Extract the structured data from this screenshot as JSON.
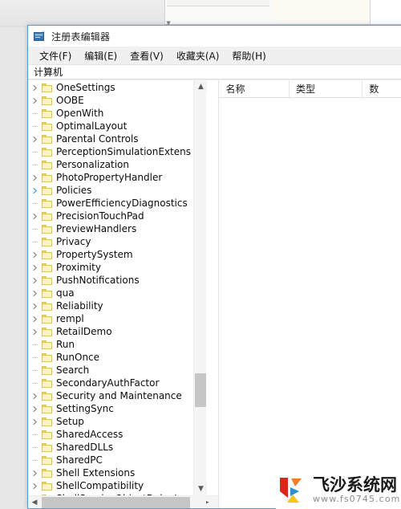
{
  "background": {
    "chevron_icon": "chevron-down-icon"
  },
  "window": {
    "title": "注册表编辑器",
    "app_icon": "registry-editor-icon",
    "menus": [
      {
        "label": "文件(F)",
        "name": "menu-file"
      },
      {
        "label": "编辑(E)",
        "name": "menu-edit"
      },
      {
        "label": "查看(V)",
        "name": "menu-view"
      },
      {
        "label": "收藏夹(A)",
        "name": "menu-favorites"
      },
      {
        "label": "帮助(H)",
        "name": "menu-help"
      }
    ],
    "address": "计算机"
  },
  "tree": {
    "nodes": [
      {
        "label": "OneSettings",
        "expandable": true,
        "highlight": false
      },
      {
        "label": "OOBE",
        "expandable": true,
        "highlight": false
      },
      {
        "label": "OpenWith",
        "expandable": false,
        "highlight": false
      },
      {
        "label": "OptimalLayout",
        "expandable": false,
        "highlight": false
      },
      {
        "label": "Parental Controls",
        "expandable": true,
        "highlight": false
      },
      {
        "label": "PerceptionSimulationExtens",
        "expandable": false,
        "highlight": false
      },
      {
        "label": "Personalization",
        "expandable": false,
        "highlight": false
      },
      {
        "label": "PhotoPropertyHandler",
        "expandable": true,
        "highlight": false
      },
      {
        "label": "Policies",
        "expandable": true,
        "highlight": true
      },
      {
        "label": "PowerEfficiencyDiagnostics",
        "expandable": false,
        "highlight": false
      },
      {
        "label": "PrecisionTouchPad",
        "expandable": true,
        "highlight": false
      },
      {
        "label": "PreviewHandlers",
        "expandable": false,
        "highlight": false
      },
      {
        "label": "Privacy",
        "expandable": false,
        "highlight": false
      },
      {
        "label": "PropertySystem",
        "expandable": true,
        "highlight": false
      },
      {
        "label": "Proximity",
        "expandable": true,
        "highlight": false
      },
      {
        "label": "PushNotifications",
        "expandable": true,
        "highlight": false
      },
      {
        "label": "qua",
        "expandable": true,
        "highlight": false
      },
      {
        "label": "Reliability",
        "expandable": true,
        "highlight": false
      },
      {
        "label": "rempl",
        "expandable": true,
        "highlight": false
      },
      {
        "label": "RetailDemo",
        "expandable": true,
        "highlight": false
      },
      {
        "label": "Run",
        "expandable": false,
        "highlight": false
      },
      {
        "label": "RunOnce",
        "expandable": false,
        "highlight": false
      },
      {
        "label": "Search",
        "expandable": false,
        "highlight": false
      },
      {
        "label": "SecondaryAuthFactor",
        "expandable": false,
        "highlight": false
      },
      {
        "label": "Security and Maintenance",
        "expandable": true,
        "highlight": false
      },
      {
        "label": "SettingSync",
        "expandable": true,
        "highlight": false
      },
      {
        "label": "Setup",
        "expandable": true,
        "highlight": false
      },
      {
        "label": "SharedAccess",
        "expandable": false,
        "highlight": false
      },
      {
        "label": "SharedDLLs",
        "expandable": false,
        "highlight": false
      },
      {
        "label": "SharedPC",
        "expandable": false,
        "highlight": false
      },
      {
        "label": "Shell Extensions",
        "expandable": true,
        "highlight": false
      },
      {
        "label": "ShellCompatibility",
        "expandable": true,
        "highlight": false
      },
      {
        "label": "ShellServiceObjectDelayLoa",
        "expandable": false,
        "highlight": false
      }
    ],
    "scroll_up_icon": "chevron-up-icon",
    "scroll_down_icon": "chevron-down-icon",
    "scroll_left_icon": "chevron-left-icon",
    "scroll_right_icon": "chevron-right-icon"
  },
  "list": {
    "columns": [
      {
        "label": "名称",
        "name": "column-name"
      },
      {
        "label": "类型",
        "name": "column-type"
      },
      {
        "label": "数",
        "name": "column-data"
      }
    ],
    "rows": []
  },
  "watermark": {
    "title": "飞沙系统网",
    "url": "www.fs0745.com",
    "logo_icon": "feisha-logo-icon",
    "colors": {
      "red": "#e2231a",
      "orange": "#f08030",
      "blue": "#2b8fd4",
      "yellow": "#f5c518"
    }
  }
}
